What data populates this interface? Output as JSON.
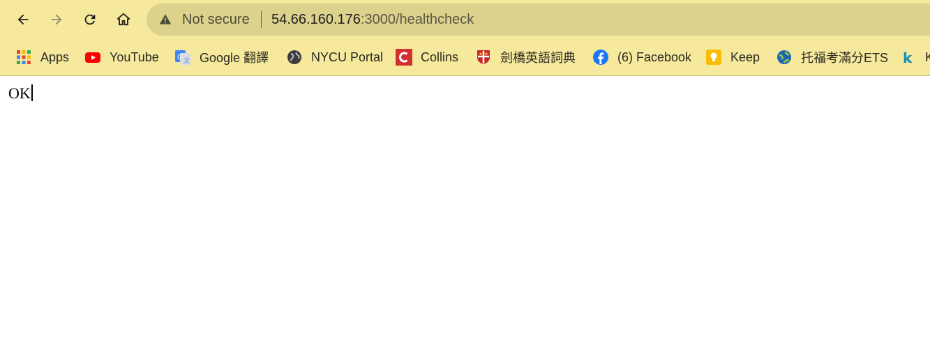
{
  "toolbar": {
    "security_label": "Not secure",
    "url_host": "54.66.160.176",
    "url_rest": ":3000/healthcheck"
  },
  "bookmarks": [
    {
      "label": "Apps",
      "icon": "apps-grid-icon"
    },
    {
      "label": "YouTube",
      "icon": "youtube-icon"
    },
    {
      "label": "Google 翻譯",
      "icon": "google-translate-icon"
    },
    {
      "label": "NYCU Portal",
      "icon": "globe-icon"
    },
    {
      "label": "Collins",
      "icon": "collins-icon"
    },
    {
      "label": "劍橋英語詞典",
      "icon": "cambridge-shield-icon"
    },
    {
      "label": "(6) Facebook",
      "icon": "facebook-icon"
    },
    {
      "label": "Keep",
      "icon": "keep-icon"
    },
    {
      "label": "托福考滿分ETS",
      "icon": "ets-globe-icon"
    },
    {
      "label": "K",
      "icon": "k-icon"
    }
  ],
  "page": {
    "body_text": "OK"
  },
  "colors": {
    "toolbar_bg": "#f6e89c",
    "omnibox_bg": "#dcd28c"
  }
}
